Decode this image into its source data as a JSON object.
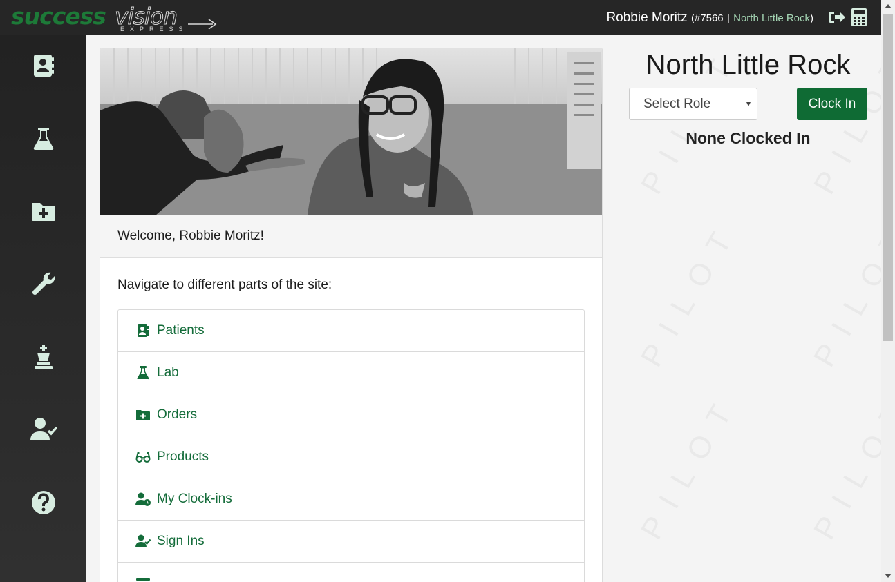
{
  "header": {
    "logo": {
      "word1": "success",
      "word2": "vision",
      "subtitle": "EXPRESS"
    },
    "user_name": "Robbie Moritz",
    "user_id_open": "(#7566",
    "separator": "|",
    "location_link": "North Little Rock",
    "close_paren": ")",
    "icons": [
      "logout-icon",
      "calculator-icon"
    ]
  },
  "sidebar": {
    "items": [
      {
        "name": "patients",
        "icon": "address-book-icon"
      },
      {
        "name": "lab",
        "icon": "flask-icon"
      },
      {
        "name": "orders",
        "icon": "folder-plus-icon"
      },
      {
        "name": "tools",
        "icon": "wrench-icon"
      },
      {
        "name": "admin",
        "icon": "chess-king-icon"
      },
      {
        "name": "sign-ins",
        "icon": "user-check-icon"
      },
      {
        "name": "help",
        "icon": "question-circle-icon"
      }
    ]
  },
  "main": {
    "hero_image": "photo-of-eye-care-worker-smiling-with-elderly-patient",
    "welcome": "Welcome, Robbie Moritz!",
    "nav_title": "Navigate to different parts of the site:",
    "nav_items": [
      {
        "label": "Patients",
        "icon": "address-book-icon"
      },
      {
        "label": "Lab",
        "icon": "flask-icon"
      },
      {
        "label": "Orders",
        "icon": "folder-plus-icon"
      },
      {
        "label": "Products",
        "icon": "glasses-icon"
      },
      {
        "label": "My Clock-ins",
        "icon": "user-clock-icon"
      },
      {
        "label": "Sign Ins",
        "icon": "user-check-icon"
      }
    ]
  },
  "right_panel": {
    "location": "North Little Rock",
    "role_select": {
      "selected": "Select Role"
    },
    "clock_in_label": "Clock In",
    "status": "None Clocked In",
    "watermark": "PILOT"
  },
  "colors": {
    "brand_green": "#0f6b34",
    "link_green": "#146c3a",
    "topbar": "#262626",
    "sidebar_icon": "#d7ece0"
  }
}
